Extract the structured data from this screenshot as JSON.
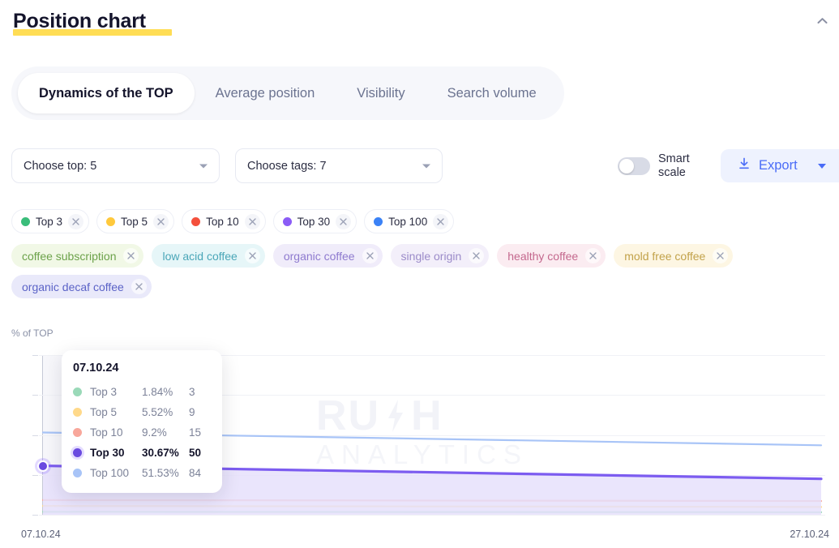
{
  "header": {
    "title": "Position chart",
    "collapse_icon": "chevron-up-icon",
    "highlight_color": "#FFDD55"
  },
  "tabs": [
    {
      "label": "Dynamics of the TOP",
      "active": true
    },
    {
      "label": "Average position",
      "active": false
    },
    {
      "label": "Visibility",
      "active": false
    },
    {
      "label": "Search volume",
      "active": false
    }
  ],
  "controls": {
    "choose_top": {
      "label": "Choose top: 5",
      "icon": "chevron-down-icon"
    },
    "choose_tags": {
      "label": "Choose tags: 7",
      "icon": "chevron-down-icon"
    },
    "smart_scale": {
      "label": "Smart scale",
      "enabled": false
    },
    "export": {
      "label": "Export",
      "icon": "download-icon",
      "caret": "chevron-down-icon",
      "bg": "#EEF2FE",
      "fg": "#4A6CF7"
    }
  },
  "top_chips": [
    {
      "label": "Top 3",
      "color": "#3ABD7A",
      "remove_icon": "close-icon"
    },
    {
      "label": "Top 5",
      "color": "#FFC93C",
      "remove_icon": "close-icon"
    },
    {
      "label": "Top 10",
      "color": "#F4503C",
      "remove_icon": "close-icon"
    },
    {
      "label": "Top 30",
      "color": "#8B5CF6",
      "remove_icon": "close-icon"
    },
    {
      "label": "Top 100",
      "color": "#3B82F6",
      "remove_icon": "close-icon"
    }
  ],
  "tag_chips": [
    {
      "label": "coffee subscription",
      "fg": "#6CA24A",
      "bg": "#F1F8E6",
      "remove_icon": "close-icon"
    },
    {
      "label": "low acid coffee",
      "fg": "#4AA6B8",
      "bg": "#E6F6F8",
      "remove_icon": "close-icon"
    },
    {
      "label": "organic coffee",
      "fg": "#8E7ACF",
      "bg": "#F0ECFA",
      "remove_icon": "close-icon"
    },
    {
      "label": "single origin",
      "fg": "#9B8BC9",
      "bg": "#F3EFFA",
      "remove_icon": "close-icon"
    },
    {
      "label": "healthy coffee",
      "fg": "#C4688D",
      "bg": "#FBECF1",
      "remove_icon": "close-icon"
    },
    {
      "label": "mold free coffee",
      "fg": "#C2A24A",
      "bg": "#FDF6E3",
      "remove_icon": "close-icon"
    },
    {
      "label": "organic decaf coffee",
      "fg": "#5B63C7",
      "bg": "#E9E9FA",
      "remove_icon": "close-icon"
    }
  ],
  "tooltip": {
    "date": "07.10.24",
    "rows": [
      {
        "name": "Top 3",
        "percent": "1.84%",
        "count": "3",
        "color": "#9AD9B8",
        "active": false
      },
      {
        "name": "Top 5",
        "percent": "5.52%",
        "count": "9",
        "color": "#FFD98A",
        "active": false
      },
      {
        "name": "Top 10",
        "percent": "9.2%",
        "count": "15",
        "color": "#F8A79B",
        "active": false
      },
      {
        "name": "Top 30",
        "percent": "30.67%",
        "count": "50",
        "color": "#6A4AE0",
        "active": true
      },
      {
        "name": "Top 100",
        "percent": "51.53%",
        "count": "84",
        "color": "#A8C4F7",
        "active": false
      }
    ]
  },
  "watermark": {
    "line1": "RU",
    "bolt": "⚡",
    "line1b": "H",
    "line2": "ANALYTICS"
  },
  "chart_data": {
    "type": "line",
    "title": "Position chart",
    "ylabel": "% of TOP",
    "xlabel": "",
    "ylim": [
      0,
      100
    ],
    "yticks": [
      0,
      25,
      50,
      75,
      100
    ],
    "x": [
      "07.10.24",
      "27.10.24"
    ],
    "xticks": [
      "07.10.24",
      "27.10.24"
    ],
    "grid": true,
    "legend_position": "chips-above-chart",
    "series": [
      {
        "name": "Top 3",
        "color": "#9AD9B8",
        "values": [
          1.84,
          1.6
        ]
      },
      {
        "name": "Top 5",
        "color": "#FFD98A",
        "values": [
          5.52,
          4.9
        ]
      },
      {
        "name": "Top 10",
        "color": "#F8A79B",
        "values": [
          9.2,
          8.6
        ]
      },
      {
        "name": "Top 30",
        "color": "#7C5CF0",
        "values": [
          30.67,
          22.5
        ]
      },
      {
        "name": "Top 100",
        "color": "#A8C4F7",
        "values": [
          51.53,
          43.5
        ]
      }
    ],
    "highlighted_point": {
      "series": "Top 30",
      "x": "07.10.24",
      "y": 30.67,
      "count": 50
    }
  }
}
